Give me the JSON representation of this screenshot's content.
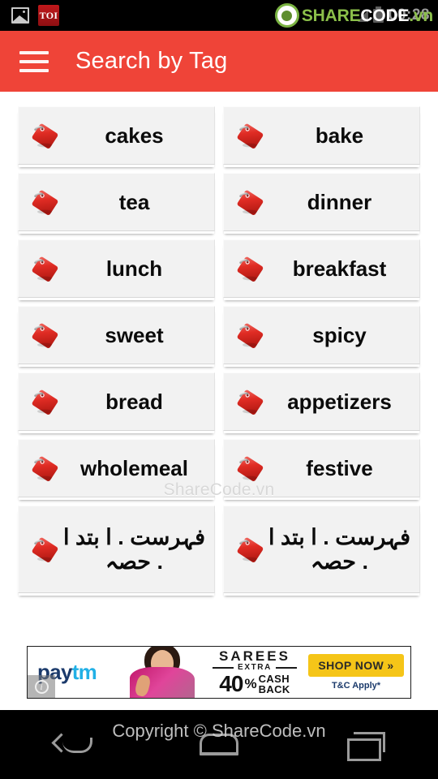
{
  "status_bar": {
    "gallery_icon": "image-icon",
    "toi_icon_label": "TOI",
    "clock": "00:28",
    "signal_icon": "signal-icon",
    "battery_icon": "battery-icon"
  },
  "watermark": {
    "top_share": "SHARE",
    "top_code": "CODE",
    "top_vn": ".vn",
    "center": "ShareCode.vn",
    "bottom": "Copyright © ShareCode.vn"
  },
  "appbar": {
    "menu_icon": "hamburger-icon",
    "title": "Search by Tag",
    "background_color": "#ef4438"
  },
  "tags": [
    {
      "label": "cakes",
      "rtl": false
    },
    {
      "label": "bake",
      "rtl": false
    },
    {
      "label": "tea",
      "rtl": false
    },
    {
      "label": "dinner",
      "rtl": false
    },
    {
      "label": "lunch",
      "rtl": false
    },
    {
      "label": "breakfast",
      "rtl": false
    },
    {
      "label": "sweet",
      "rtl": false
    },
    {
      "label": "spicy",
      "rtl": false
    },
    {
      "label": "bread",
      "rtl": false
    },
    {
      "label": "appetizers",
      "rtl": false
    },
    {
      "label": "wholemeal",
      "rtl": false
    },
    {
      "label": "festive",
      "rtl": false
    },
    {
      "label": "فہرست . ا بتد ا . حصہ",
      "rtl": true
    },
    {
      "label": "فہرست . ا بتد ا . حصہ",
      "rtl": true
    }
  ],
  "tag_icon_name": "price-tag-icon",
  "ad": {
    "brand_1": "pay",
    "brand_2": "tm",
    "headline": "SAREES",
    "extra": "EXTRA",
    "percent_number": "40",
    "percent_symbol": "%",
    "cash": "CASH",
    "back": "BACK",
    "cta": "SHOP NOW »",
    "terms": "T&C Apply*",
    "info_icon": "adchoices-info-icon",
    "cta_color": "#f5c518"
  },
  "navbar": {
    "back_label": "back-button",
    "home_label": "home-button",
    "recents_label": "recents-button"
  }
}
